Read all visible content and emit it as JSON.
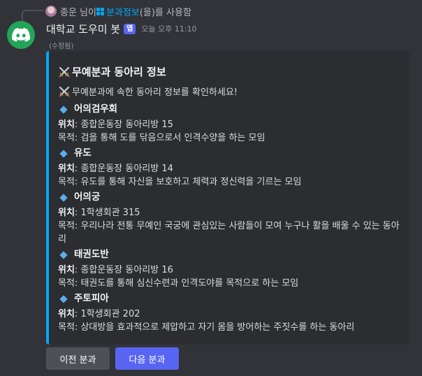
{
  "reply": {
    "user": "종운 님이",
    "command": "분과정보",
    "suffix": "(을)를 사용함"
  },
  "message": {
    "author": "대학교 도우미 봇",
    "app_badge": "앱",
    "timestamp": "오늘 오후 11:10",
    "edited": "(수정됨)"
  },
  "embed": {
    "accent_color": "#00a8fc",
    "title": "무예분과 동아리 정보",
    "description": "무예분과에 속한 동아리 정보를 확인하세요!",
    "location_label": "위치",
    "purpose_label": "목적",
    "clubs": [
      {
        "name": "어의검우회",
        "location": "종합운동장 동아리방 15",
        "purpose": "검을 통해 도를 닦음으로서 인격수양을 하는 모임"
      },
      {
        "name": "유도",
        "location": "종합운동장 동아리방 14",
        "purpose": "유도를 통해 자신을 보호하고 체력과 정신력을 기르는 모임"
      },
      {
        "name": "어의궁",
        "location": "1학생회관 315",
        "purpose": "우리나라 전통 무예인 국궁에 관심있는 사람들이 모여 누구나 활을 배울 수 있는 동아리"
      },
      {
        "name": "태권도반",
        "location": "종합운동장 동아리방 16",
        "purpose": "태권도를 통해 심신수련과 인격도야를 목적으로 하는 모임"
      },
      {
        "name": "주토피아",
        "location": "1학생회관 202",
        "purpose": "상대방을 효과적으로 제압하고 자기 몸을 방어하는 주짓수를 하는 동아리"
      }
    ]
  },
  "buttons": {
    "prev": "이전 분과",
    "next": "다음 분과"
  },
  "icons": {
    "avatar": "discord-logo-icon",
    "title_emoji": "crossed-swords-icon",
    "bullet": "blue-diamond-icon",
    "command": "app-command-icon"
  },
  "colors": {
    "background": "#313338",
    "embed_bg": "#2b2d31",
    "avatar_bg": "#23a559",
    "primary_button": "#5865f2",
    "secondary_button": "#4e5058"
  }
}
